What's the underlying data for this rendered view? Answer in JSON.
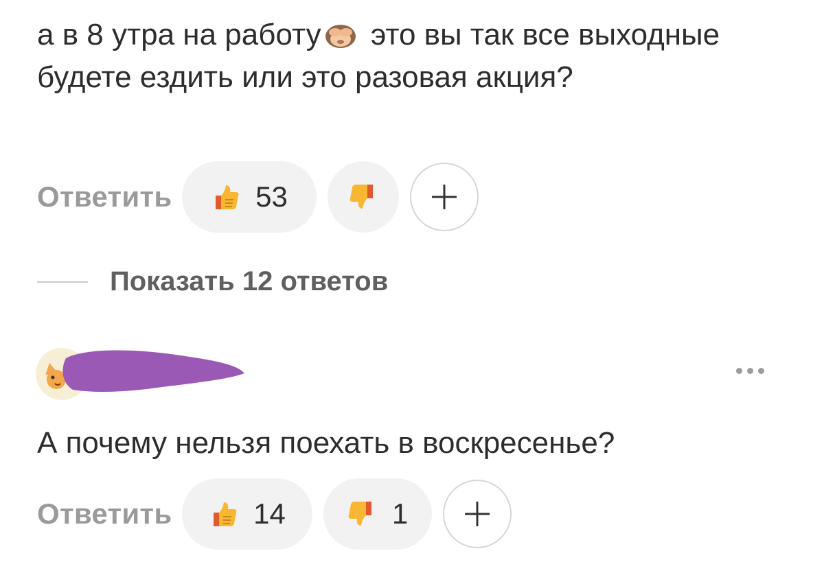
{
  "comment1": {
    "text_before_emoji": "а в 8 утра на работу",
    "emoji": "see-no-evil-monkey-icon",
    "text_after_emoji": " это вы так все выходные будете ездить или это разовая акция?",
    "reply_label": "Ответить",
    "likes": "53",
    "dislikes": ""
  },
  "replies_toggle": {
    "label": "Показать 12 ответов"
  },
  "comment2": {
    "avatar": "cat-avatar-icon",
    "author_name_redacted": true,
    "text": "А почему нельзя поехать в воскресенье?",
    "reply_label": "Ответить",
    "likes": "14",
    "dislikes": "1"
  },
  "colors": {
    "text": "#2d2d2d",
    "muted": "#9a9a9a",
    "pill_bg": "#f2f2f2",
    "redaction": "#9b59b6"
  }
}
